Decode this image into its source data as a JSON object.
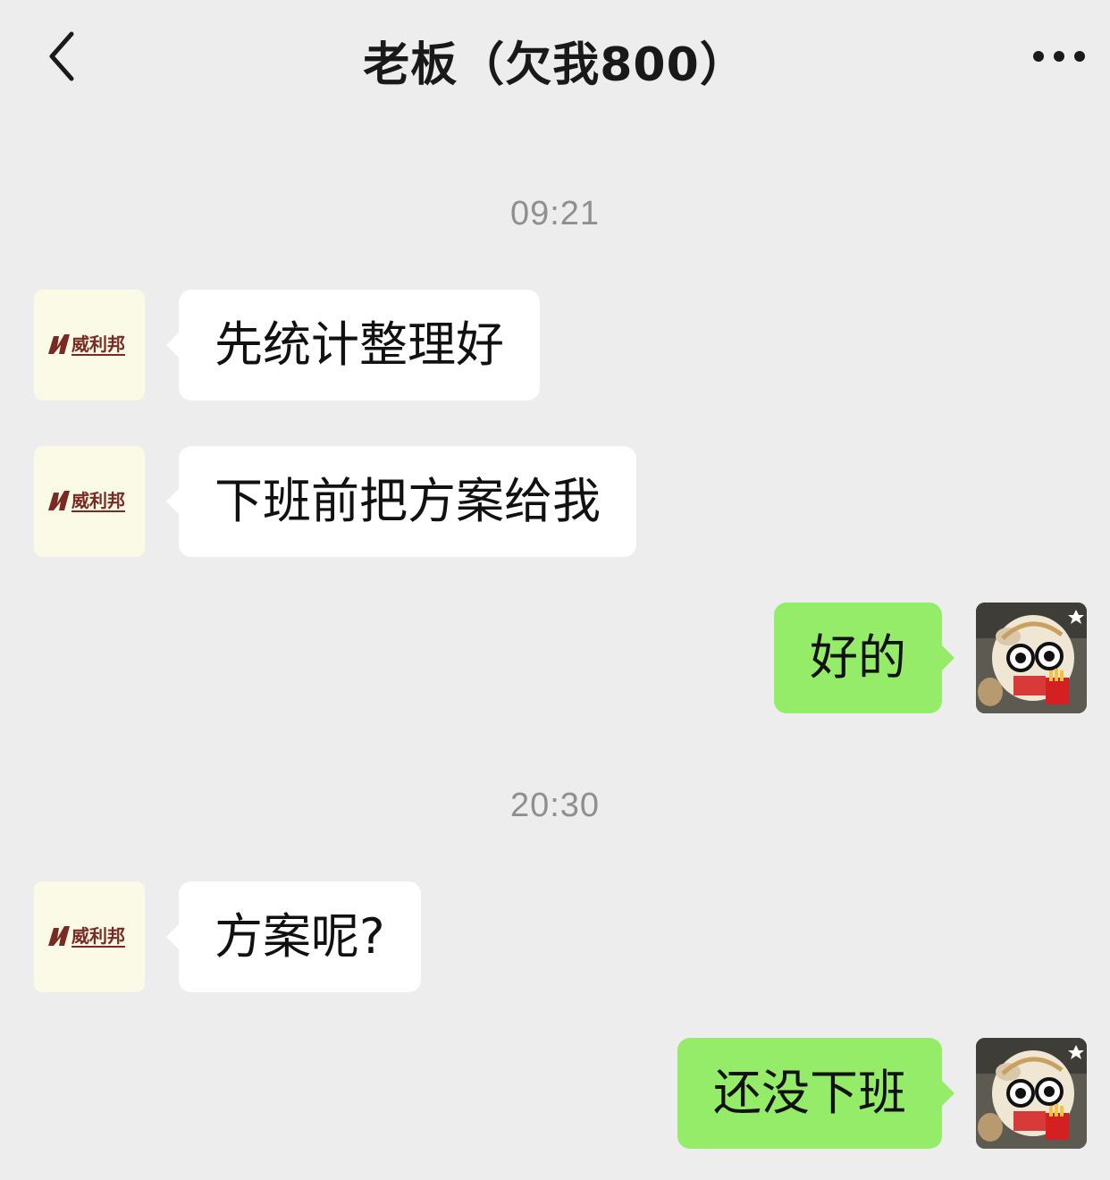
{
  "header": {
    "title": "老板（欠我800）"
  },
  "messages": [
    {
      "type": "time",
      "text": "09:21"
    },
    {
      "type": "msg",
      "side": "left",
      "text": "先统计整理好"
    },
    {
      "type": "msg",
      "side": "left",
      "text": "下班前把方案给我"
    },
    {
      "type": "msg",
      "side": "right",
      "text": "好的"
    },
    {
      "type": "time",
      "text": "20:30"
    },
    {
      "type": "msg",
      "side": "left",
      "text": "方案呢?"
    },
    {
      "type": "msg",
      "side": "right",
      "text": "还没下班"
    }
  ],
  "avatars": {
    "left_logo_text": "威利邦",
    "left_icon": "company-logo",
    "right_icon": "plush-toy-avatar"
  },
  "colors": {
    "background": "#ededed",
    "incoming_bubble": "#ffffff",
    "outgoing_bubble": "#95ec69",
    "timestamp": "#8f8f8f"
  }
}
